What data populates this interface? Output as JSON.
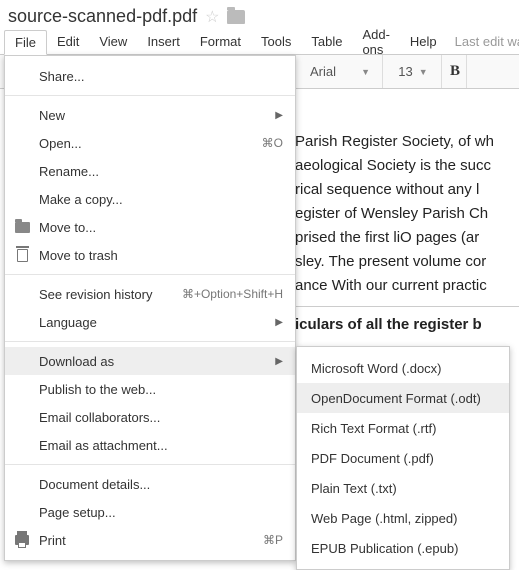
{
  "doc_title": "source-scanned-pdf.pdf",
  "menubar": {
    "items": [
      "File",
      "Edit",
      "View",
      "Insert",
      "Format",
      "Tools",
      "Table",
      "Add-ons",
      "Help"
    ],
    "last_edit": "Last edit was"
  },
  "toolbar": {
    "font": "Arial",
    "size": "13",
    "bold": "B"
  },
  "file_menu": {
    "share": "Share...",
    "new": "New",
    "open": "Open...",
    "open_shortcut": "⌘O",
    "rename": "Rename...",
    "make_copy": "Make a copy...",
    "move_to": "Move to...",
    "move_to_trash": "Move to trash",
    "revision": "See revision history",
    "revision_shortcut": "⌘+Option+Shift+H",
    "language": "Language",
    "download_as": "Download as",
    "publish": "Publish to the web...",
    "email_collab": "Email collaborators...",
    "email_attach": "Email as attachment...",
    "doc_details": "Document details...",
    "page_setup": "Page setup...",
    "print": "Print",
    "print_shortcut": "⌘P"
  },
  "download_submenu": {
    "items": [
      "Microsoft Word (.docx)",
      "OpenDocument Format (.odt)",
      "Rich Text Format (.rtf)",
      "PDF Document (.pdf)",
      "Plain Text (.txt)",
      "Web Page (.html, zipped)",
      "EPUB Publication (.epub)"
    ],
    "highlighted_index": 1
  },
  "document_body": {
    "l1": "Parish Register Society, of wh",
    "l2": "aeological Society is the succ",
    "l3": "rical sequence without any l",
    "l4": "egister of Wensley Parish Ch",
    "l5": "prised the first liO pages (ar",
    "l6": "sley. The present volume cor",
    "l7": "ance With our current practic",
    "l8": "iculars of all the register b"
  }
}
